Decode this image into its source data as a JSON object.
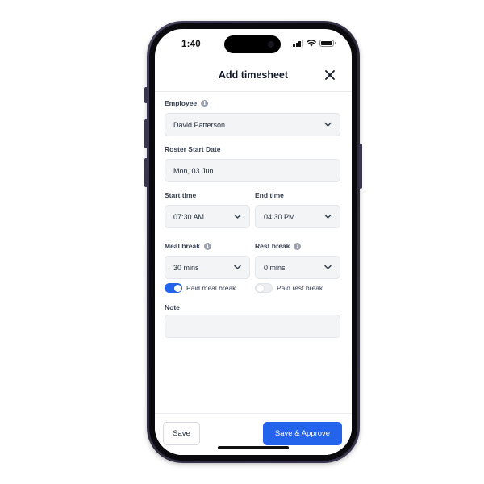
{
  "status_bar": {
    "time": "1:40"
  },
  "header": {
    "title": "Add timesheet"
  },
  "form": {
    "employee": {
      "label": "Employee",
      "value": "David Patterson"
    },
    "roster_start": {
      "label": "Roster Start Date",
      "value": "Mon, 03 Jun"
    },
    "start_time": {
      "label": "Start time",
      "value": "07:30 AM"
    },
    "end_time": {
      "label": "End time",
      "value": "04:30 PM"
    },
    "meal_break": {
      "label": "Meal break",
      "value": "30 mins"
    },
    "rest_break": {
      "label": "Rest break",
      "value": "0 mins"
    },
    "paid_meal_break": {
      "label": "Paid meal break",
      "on": true
    },
    "paid_rest_break": {
      "label": "Paid rest break",
      "on": false
    },
    "note": {
      "label": "Note",
      "value": ""
    }
  },
  "footer": {
    "save_label": "Save",
    "approve_label": "Save & Approve"
  },
  "colors": {
    "accent": "#2463eb",
    "field_bg": "#f3f4f6",
    "text": "#1f2937"
  },
  "icons": [
    "close-icon",
    "info-icon",
    "chevron-down-icon",
    "wifi-icon",
    "signal-icon",
    "battery-icon"
  ]
}
